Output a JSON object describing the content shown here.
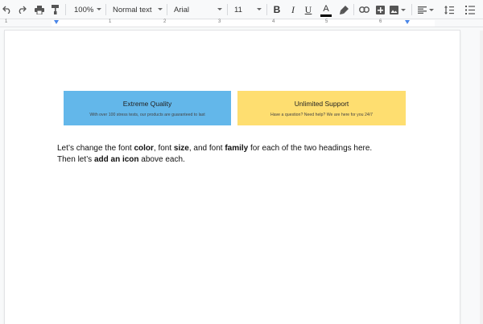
{
  "toolbar": {
    "zoom": "100%",
    "style": "Normal text",
    "font": "Arial",
    "size": "11",
    "bold_label": "B",
    "italic_label": "I",
    "underline_label": "U",
    "text_color_label": "A",
    "text_color": "#000000"
  },
  "ruler": {
    "numbers": [
      "1",
      "1",
      "2",
      "3",
      "4",
      "5",
      "6"
    ]
  },
  "cards": [
    {
      "title": "Extreme Quality",
      "subtitle": "With over 100 stress tests, our products are guaranteed to last",
      "color": "#63b7ea"
    },
    {
      "title": "Unlimited Support",
      "subtitle": "Have a question? Need help? We are here for you 24/7",
      "color": "#fede70"
    }
  ],
  "paragraph": {
    "line1_a": "Let’s change the font ",
    "line1_b": "color",
    "line1_c": ", font ",
    "line1_d": "size",
    "line1_e": ", and font ",
    "line1_f": "family",
    "line1_g": " for each of the two headings here.",
    "line2_a": "Then let’s ",
    "line2_b": "add an icon",
    "line2_c": " above each."
  },
  "colors": {
    "accent_ruler": "#4a86e8"
  },
  "icons": [
    "undo-icon",
    "redo-icon",
    "print-icon",
    "paint-format-icon",
    "highlighter-icon",
    "link-icon",
    "add-comment-icon",
    "insert-image-icon",
    "align-left-icon",
    "line-spacing-icon",
    "numbered-list-icon"
  ]
}
